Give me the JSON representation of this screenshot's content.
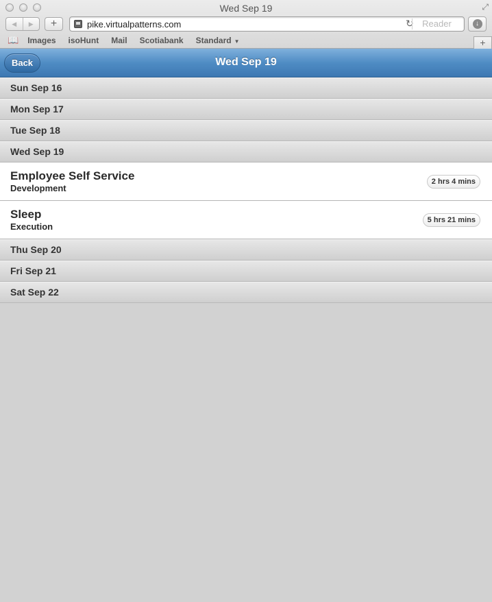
{
  "window": {
    "title": "Wed Sep 19",
    "url": "pike.virtualpatterns.com",
    "reader_label": "Reader"
  },
  "bookmarks": [
    {
      "label": "Images"
    },
    {
      "label": "isoHunt"
    },
    {
      "label": "Mail"
    },
    {
      "label": "Scotiabank"
    },
    {
      "label": "Standard"
    }
  ],
  "header": {
    "back_label": "Back",
    "title": "Wed Sep 19"
  },
  "days": {
    "sun": "Sun Sep 16",
    "mon": "Mon Sep 17",
    "tue": "Tue Sep 18",
    "wed": "Wed Sep 19",
    "thu": "Thu Sep 20",
    "fri": "Fri Sep 21",
    "sat": "Sat Sep 22"
  },
  "entries": [
    {
      "title": "Employee Self Service",
      "subtitle": "Development",
      "duration": "2 hrs 4 mins"
    },
    {
      "title": "Sleep",
      "subtitle": "Execution",
      "duration": "5 hrs 21 mins"
    }
  ],
  "colors": {
    "header_blue": "#4f8cc4",
    "background": "#d2d2d2"
  }
}
